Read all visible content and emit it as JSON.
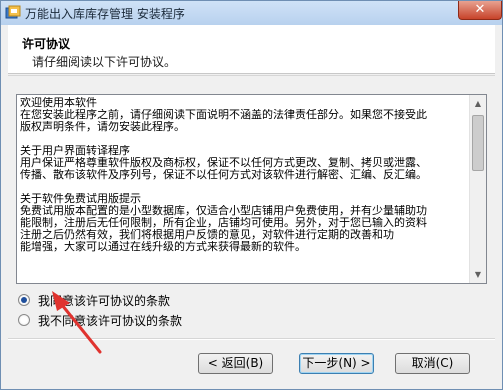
{
  "window": {
    "title": "万能出入库库存管理 安装程序",
    "close_glyph": "✕"
  },
  "header": {
    "title": "许可协议",
    "subtitle": "请仔细阅读以下许可协议。"
  },
  "license": {
    "paragraphs": [
      [
        "欢迎使用本软件",
        "在您安装此程序之前，请仔细阅读下面说明不涵盖的法律责任部分。如果您不接受此",
        "版权声明条件，请勿安装此程序。"
      ],
      [
        "关于用户界面转译程序",
        "用户保证严格尊重软件版权及商标权，保证不以任何方式更改、复制、拷贝或泄露、",
        "传播、散布该软件及序列号，保证不以任何方式对该软件进行解密、汇编、反汇编。"
      ],
      [
        "关于软件免费试用版提示",
        "免费试用版本配置的是小型数据库，仅适合小型店铺用户免费使用，并有少量辅助功",
        "能限制，注册后无任何限制，所有企业，店铺均可使用。另外，对于您已输入的资料",
        "注册之后仍然有效，我们将根据用户反馈的意见，对软件进行定期的改善和功",
        "能增强，大家可以通过在线升级的方式来获得最新的软件。"
      ]
    ]
  },
  "agreement": {
    "accept_label": "我同意该许可协议的条款",
    "decline_label": "我不同意该许可协议的条款",
    "selected": "accept"
  },
  "buttons": {
    "back": "< 返回(B)",
    "next": "下一步(N) >",
    "cancel": "取消(C)"
  },
  "colors": {
    "annotation_arrow": "#e0332f",
    "radio_selected": "#1f4f9c"
  }
}
